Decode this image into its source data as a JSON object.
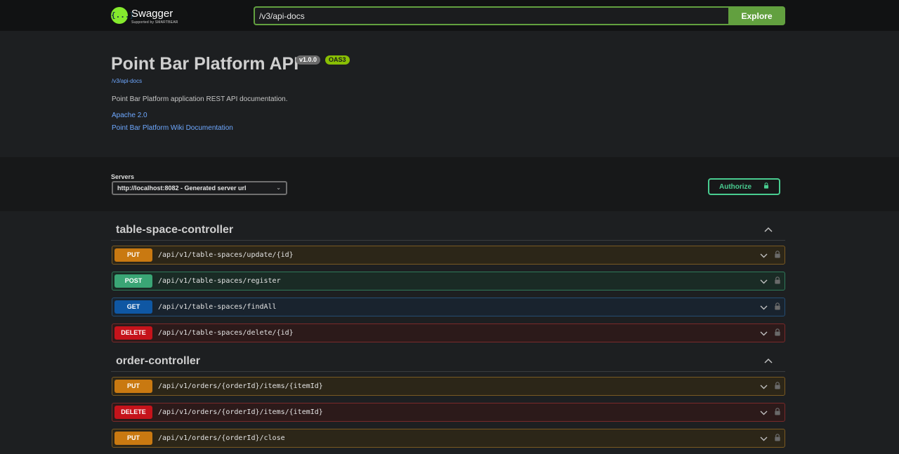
{
  "topbar": {
    "logo_name": "Swagger",
    "logo_glyph": "{...}",
    "logo_sub": "Supported by SMARTBEAR",
    "url_value": "/v3/api-docs",
    "explore_label": "Explore"
  },
  "info": {
    "title": "Point Bar Platform API",
    "version_badge": "v1.0.0",
    "oas_badge": "OAS3",
    "spec_link": "/v3/api-docs",
    "description": "Point Bar Platform application REST API documentation.",
    "license_link": "Apache 2.0",
    "wiki_link": "Point Bar Platform Wiki Documentation"
  },
  "servers": {
    "label": "Servers",
    "selected": "http://localhost:8082 - Generated server url",
    "authorize_label": "Authorize"
  },
  "colors": {
    "put": "#c97911",
    "post": "#3aa575",
    "get": "#0f57a3",
    "delete": "#c5131b",
    "accent": "#62a03f",
    "authorize": "#49cc90"
  },
  "controllers": [
    {
      "name": "table-space-controller",
      "operations": [
        {
          "method": "PUT",
          "path": "/api/v1/table-spaces/update/{id}"
        },
        {
          "method": "POST",
          "path": "/api/v1/table-spaces/register"
        },
        {
          "method": "GET",
          "path": "/api/v1/table-spaces/findAll"
        },
        {
          "method": "DELETE",
          "path": "/api/v1/table-spaces/delete/{id}"
        }
      ]
    },
    {
      "name": "order-controller",
      "operations": [
        {
          "method": "PUT",
          "path": "/api/v1/orders/{orderId}/items/{itemId}"
        },
        {
          "method": "DELETE",
          "path": "/api/v1/orders/{orderId}/items/{itemId}"
        },
        {
          "method": "PUT",
          "path": "/api/v1/orders/{orderId}/close"
        }
      ]
    }
  ]
}
